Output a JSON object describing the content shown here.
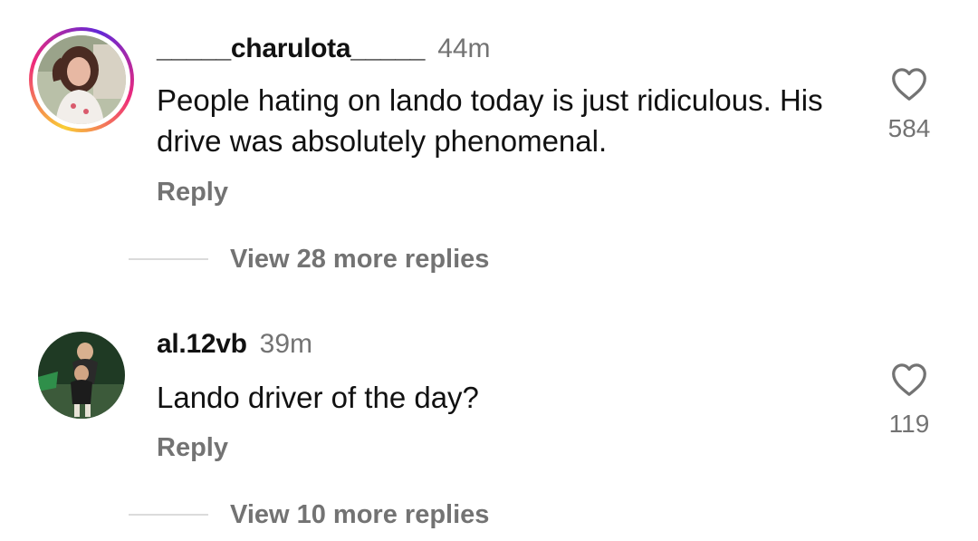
{
  "comments": [
    {
      "username": "_____charulota_____",
      "time": "44m",
      "text": "People hating on lando today is just ridiculous. His drive was absolutely phenomenal.",
      "reply_label": "Reply",
      "view_replies_label": "View 28 more replies",
      "likes": "584",
      "avatar_story_ring": true
    },
    {
      "username": "al.12vb",
      "time": "39m",
      "text": "Lando driver of the day?",
      "reply_label": "Reply",
      "view_replies_label": "View 10 more replies",
      "likes": "119",
      "avatar_story_ring": false
    }
  ],
  "icons": {
    "like": "heart-outline-icon"
  },
  "colors": {
    "secondary_text": "#737373",
    "divider": "#dbdbdb",
    "story_ring": [
      "#f9ce34",
      "#ee2a7b",
      "#6228d7"
    ]
  }
}
